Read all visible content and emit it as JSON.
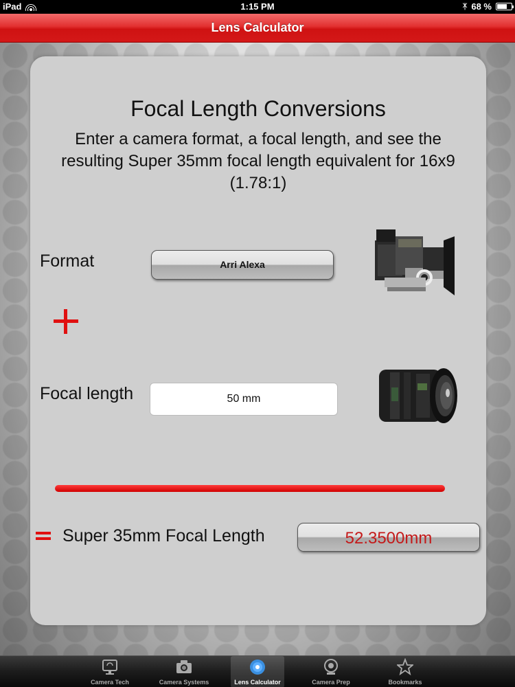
{
  "status_bar": {
    "device": "iPad",
    "time": "1:15 PM",
    "battery": "68 %",
    "battery_level": 0.68
  },
  "nav": {
    "title": "Lens Calculator"
  },
  "card": {
    "heading": "Focal Length Conversions",
    "description": "Enter a camera format, a focal length, and see the resulting Super 35mm focal length equivalent for 16x9 (1.78:1)",
    "format_label": "Format",
    "format_value": "Arri Alexa",
    "focal_label": "Focal length",
    "focal_value": "50 mm",
    "result_label": "Super 35mm Focal Length",
    "result_value": "52.3500mm"
  },
  "tabs": [
    {
      "label": "Camera Tech",
      "icon": "monitor-icon",
      "active": false
    },
    {
      "label": "Camera Systems",
      "icon": "camera-icon",
      "active": false
    },
    {
      "label": "Lens Calculator",
      "icon": "disc-icon",
      "active": true
    },
    {
      "label": "Camera Prep",
      "icon": "webcam-icon",
      "active": false
    },
    {
      "label": "Bookmarks",
      "icon": "star-icon",
      "active": false
    }
  ],
  "colors": {
    "accent_red": "#e01010",
    "nav_red": "#d41818",
    "result_text": "#c41a1a"
  }
}
